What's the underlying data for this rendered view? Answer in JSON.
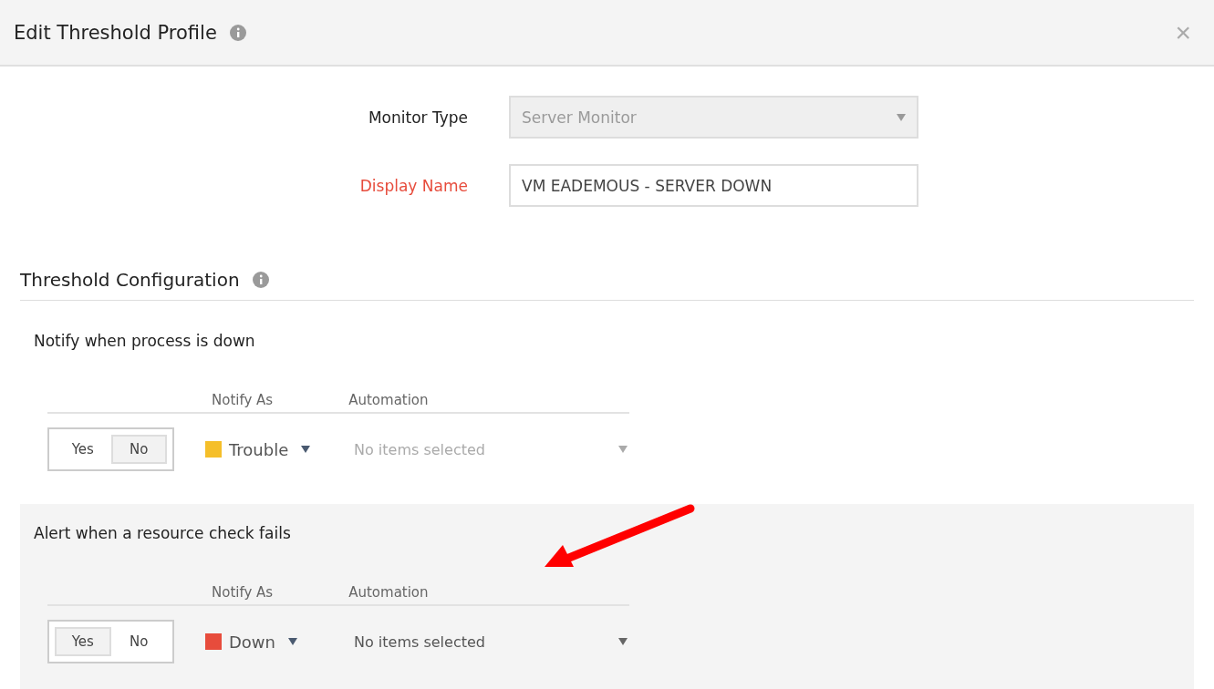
{
  "dialog": {
    "title": "Edit Threshold Profile",
    "close": "×"
  },
  "form": [
    {
      "kind": "select",
      "label": "Monitor Type",
      "required": false,
      "value": "Server Monitor",
      "disabled": true
    },
    {
      "kind": "text",
      "label": "Display Name",
      "required": true,
      "value": "VM EADEMOUS - SERVER DOWN",
      "disabled": false
    }
  ],
  "section": {
    "title": "Threshold Configuration"
  },
  "rules": [
    {
      "title": "Notify when process is down",
      "kind": "plain",
      "columns": [
        "Notify As",
        "Automation"
      ],
      "toggle": [
        {
          "label": "Yes",
          "selected": false
        },
        {
          "label": "No",
          "selected": true
        }
      ],
      "notify_as": {
        "label": "Trouble",
        "color": "#f5bf2a"
      },
      "automation": {
        "placeholder": "No items selected",
        "disabled": true
      }
    },
    {
      "title": "Alert when a resource check fails",
      "kind": "shaded",
      "columns": [
        "Notify As",
        "Automation"
      ],
      "toggle": [
        {
          "label": "Yes",
          "selected": true
        },
        {
          "label": "No",
          "selected": false
        }
      ],
      "notify_as": {
        "label": "Down",
        "color": "#e74c3c"
      },
      "automation": {
        "placeholder": "No items selected",
        "disabled": false
      }
    }
  ]
}
